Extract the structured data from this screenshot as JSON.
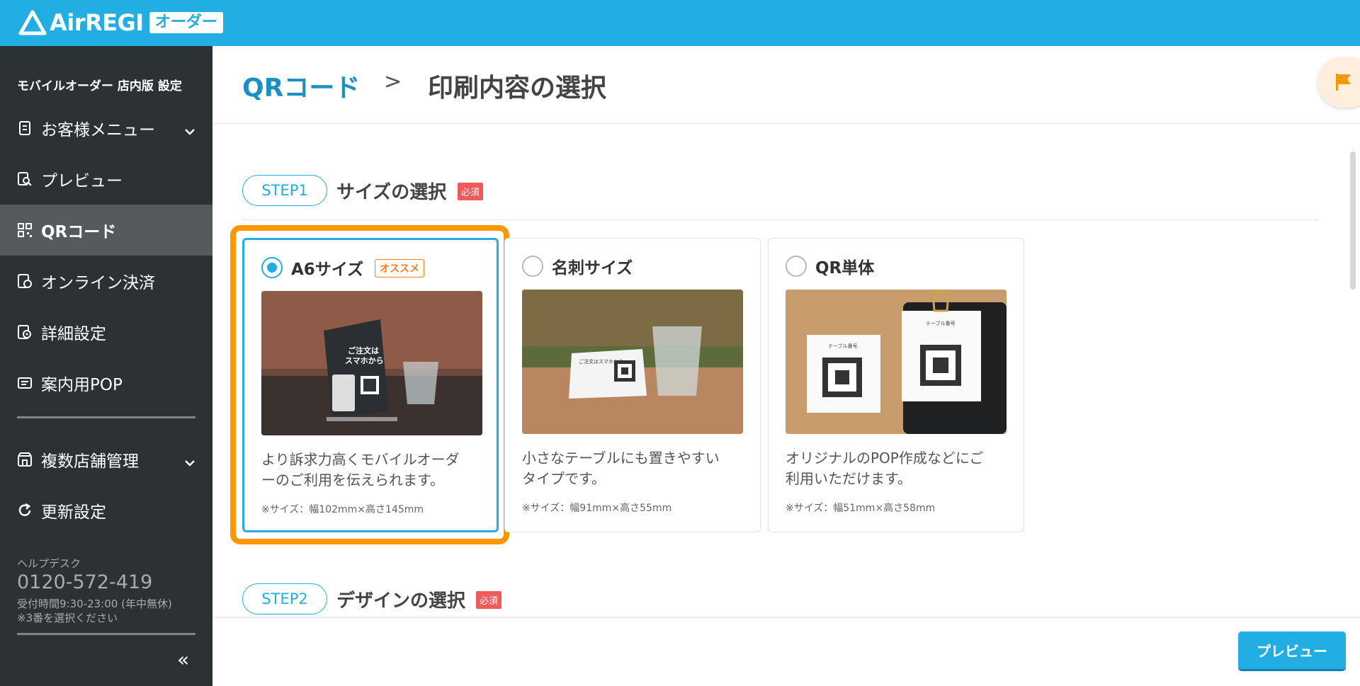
{
  "app": {
    "logo_text": "AirREGI",
    "logo_badge": "オーダー"
  },
  "sidebar": {
    "heading": "モバイルオーダー 店内版 設定",
    "items": [
      {
        "label": "お客様メニュー",
        "icon": "menu-doc-icon",
        "has_chevron": true
      },
      {
        "label": "プレビュー",
        "icon": "preview-search-icon"
      },
      {
        "label": "QRコード",
        "icon": "qr-icon",
        "active": true
      },
      {
        "label": "オンライン決済",
        "icon": "payment-icon"
      },
      {
        "label": "詳細設定",
        "icon": "settings-gear-icon"
      },
      {
        "label": "案内用POP",
        "icon": "pop-icon"
      },
      {
        "label": "複数店舗管理",
        "icon": "store-icon",
        "has_chevron": true
      },
      {
        "label": "更新設定",
        "icon": "refresh-icon"
      }
    ],
    "help": {
      "label": "ヘルプデスク",
      "phone": "0120-572-419",
      "hours": "受付時間9:30-23:00 (年中無休)",
      "note": "※3番を選択ください"
    },
    "collapse": "«"
  },
  "header": {
    "breadcrumb_link": "QRコード",
    "separator": ">",
    "title": "印刷内容の選択"
  },
  "step1": {
    "pill": "STEP1",
    "title": "サイズの選択",
    "required": "必須"
  },
  "step2": {
    "pill": "STEP2",
    "title": "デザインの選択",
    "required": "必須"
  },
  "cards": [
    {
      "label": "A6サイズ",
      "badge": "オススメ",
      "selected": true,
      "desc_line1": "より訴求力高くモバイルオーダ",
      "desc_line2": "ーのご利用を伝えられます。",
      "size": "※サイズ：幅102mm×高さ145mm",
      "img_text1": "ご注文は",
      "img_text2": "スマホから"
    },
    {
      "label": "名刺サイズ",
      "selected": false,
      "desc_line1": "小さなテーブルにも置きやすい",
      "desc_line2": "タイプです。",
      "size": "※サイズ：幅91mm×高さ55mm",
      "img_text1": "ご注文はスマホから"
    },
    {
      "label": "QR単体",
      "selected": false,
      "desc_line1": "オリジナルのPOP作成などにご",
      "desc_line2": "利用いただけます。",
      "size": "※サイズ：幅51mm×高さ58mm",
      "img_text1": "テーブル番号",
      "img_text2": "テーブル番号"
    }
  ],
  "footer": {
    "preview_button": "プレビュー"
  },
  "colors": {
    "accent": "#22aee2",
    "sidebar_bg": "#2c3135",
    "highlight": "#ff9800",
    "required": "#ef5b5b",
    "recommend": "#ff7a1a"
  }
}
